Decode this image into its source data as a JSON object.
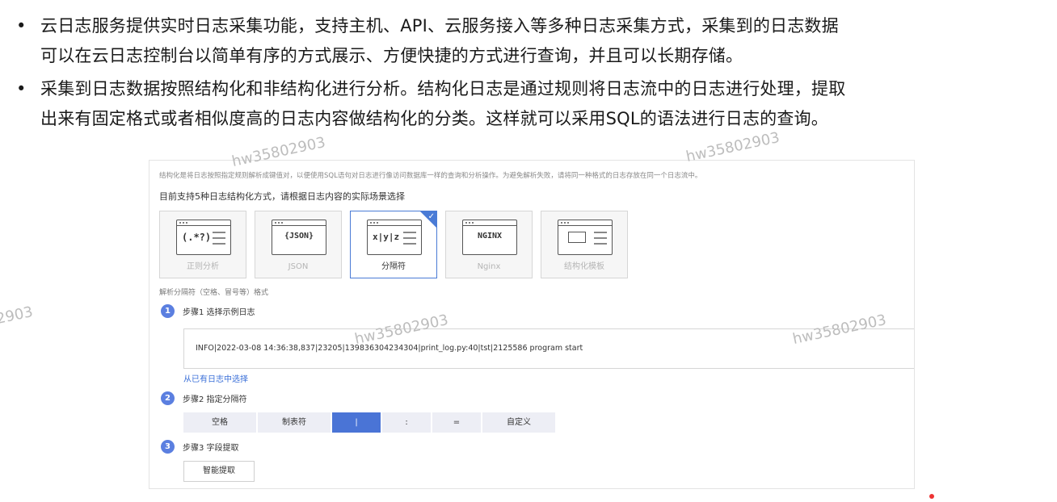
{
  "bullets": [
    {
      "line1": "云日志服务提供实时日志采集功能，支持主机、API、云服务接入等多种日志采集方式，采集到的日志数据",
      "line2": "可以在云日志控制台以简单有序的方式展示、方便快捷的方式进行查询，并且可以长期存储。"
    },
    {
      "line1": "采集到日志数据按照结构化和非结构化进行分析。结构化日志是通过规则将日志流中的日志进行处理，提取",
      "line2": "出来有固定格式或者相似度高的日志内容做结构化的分类。这样就可以采用SQL的语法进行日志的查询。"
    }
  ],
  "bullet_char": "•",
  "panel": {
    "note": "结构化是将日志按照指定规则解析成键值对，以便使用SQL语句对日志进行像访问数据库一样的查询和分析操作。为避免解析失败，请将同一种格式的日志存放在同一个日志流中。",
    "subtitle": "目前支持5种日志结构化方式，请根据日志内容的实际场景选择",
    "cards": [
      {
        "label": "正则分析",
        "art_text": "(.*?)",
        "icon": "regex-icon"
      },
      {
        "label": "JSON",
        "art_text": "{JSON}",
        "icon": "json-icon"
      },
      {
        "label": "分隔符",
        "art_text": "x|y|z",
        "icon": "delimiter-icon",
        "selected": true
      },
      {
        "label": "Nginx",
        "art_text": "NGINX",
        "icon": "nginx-icon"
      },
      {
        "label": "结构化模板",
        "art_text": "",
        "icon": "template-icon"
      }
    ],
    "format_label": "解析分隔符（空格、冒号等）格式",
    "step1": {
      "num": "1",
      "label": "步骤1 选择示例日志"
    },
    "sample_log": "INFO|2022-03-08 14:36:38,837|23205|139836304234304|print_log.py:40|tst|2125586 program start",
    "choose_link": "从已有日志中选择",
    "step2": {
      "num": "2",
      "label": "步骤2 指定分隔符"
    },
    "delimiters": [
      "空格",
      "制表符",
      "|",
      ":",
      "=",
      "自定义"
    ],
    "active_delimiter_index": 2,
    "step3": {
      "num": "3",
      "label": "步骤3 字段提取"
    },
    "extract_button": "智能提取"
  },
  "watermark": "hw35802903",
  "colors": {
    "accent": "#4a74d6",
    "step_badge": "#5b7fe0",
    "link": "#3a6fd8"
  }
}
